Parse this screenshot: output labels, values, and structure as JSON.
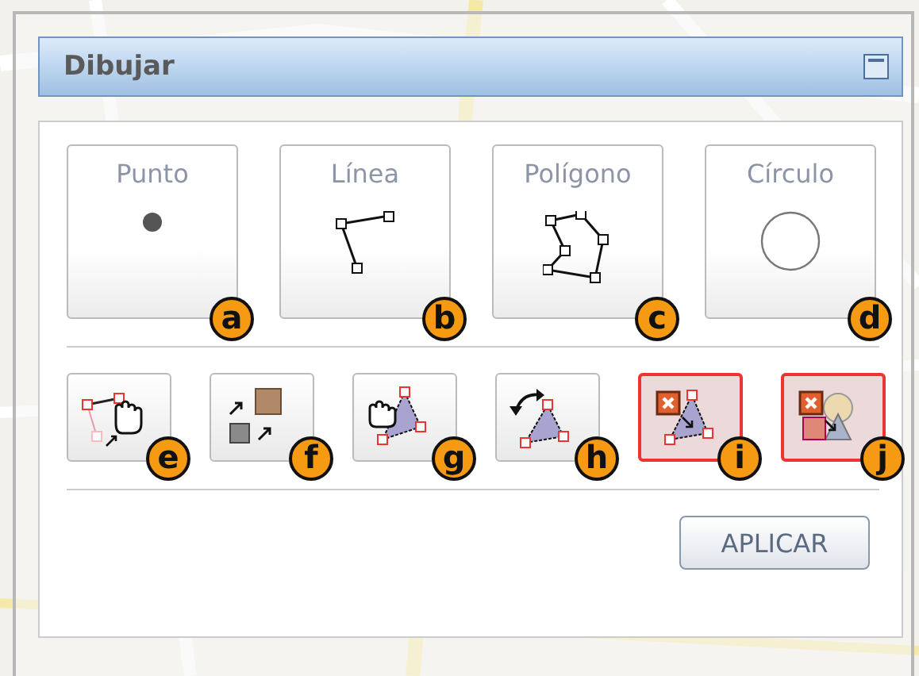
{
  "panel": {
    "title": "Dibujar"
  },
  "shape_tools": [
    {
      "label": "Punto",
      "kind": "point",
      "marker": "a"
    },
    {
      "label": "Línea",
      "kind": "line",
      "marker": "b"
    },
    {
      "label": "Polígono",
      "kind": "polygon",
      "marker": "c"
    },
    {
      "label": "Círculo",
      "kind": "circle",
      "marker": "d"
    }
  ],
  "edit_tools": [
    {
      "kind": "edit-vertices",
      "marker": "e",
      "active": false
    },
    {
      "kind": "move",
      "marker": "f",
      "active": false
    },
    {
      "kind": "drag",
      "marker": "g",
      "active": false
    },
    {
      "kind": "rotate",
      "marker": "h",
      "active": false
    },
    {
      "kind": "delete-vertex",
      "marker": "i",
      "active": true
    },
    {
      "kind": "delete-feature",
      "marker": "j",
      "active": true
    }
  ],
  "apply_button": "APLICAR"
}
